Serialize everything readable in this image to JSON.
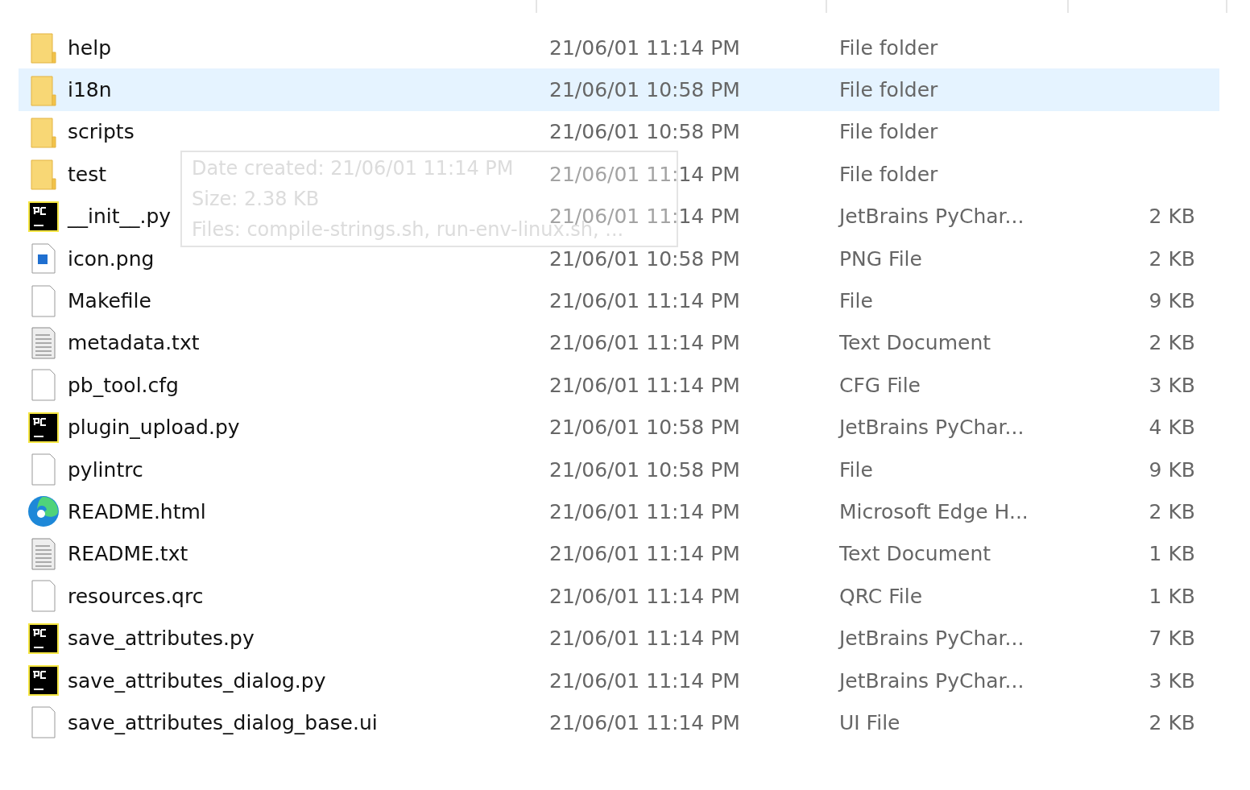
{
  "files": [
    {
      "name": "help",
      "kind": "folder",
      "date": "21/06/01 11:14 PM",
      "type": "File folder",
      "selected": false
    },
    {
      "name": "i18n",
      "kind": "folder",
      "date": "21/06/01 10:58 PM",
      "type": "File folder",
      "selected": true
    },
    {
      "name": "scripts",
      "kind": "folder",
      "date": "21/06/01 10:58 PM",
      "type": "File folder",
      "selected": false
    },
    {
      "name": "test",
      "kind": "folder",
      "date": "21/06/01 11:14 PM",
      "type": "File folder",
      "selected": false
    },
    {
      "name": "__init__.py",
      "kind": "pycharm",
      "date": "21/06/01 11:14 PM",
      "type": "JetBrains PyChar...",
      "size": "2 KB",
      "selected": false
    },
    {
      "name": "icon.png",
      "kind": "image",
      "date": "21/06/01 10:58 PM",
      "type": "PNG File",
      "size": "2 KB",
      "selected": false
    },
    {
      "name": "Makefile",
      "kind": "file",
      "date": "21/06/01 11:14 PM",
      "type": "File",
      "size": "9 KB",
      "selected": false
    },
    {
      "name": "metadata.txt",
      "kind": "text",
      "date": "21/06/01 11:14 PM",
      "type": "Text Document",
      "size": "2 KB",
      "selected": false
    },
    {
      "name": "pb_tool.cfg",
      "kind": "file",
      "date": "21/06/01 11:14 PM",
      "type": "CFG File",
      "size": "3 KB",
      "selected": false
    },
    {
      "name": "plugin_upload.py",
      "kind": "pycharm",
      "date": "21/06/01 10:58 PM",
      "type": "JetBrains PyChar...",
      "size": "4 KB",
      "selected": false
    },
    {
      "name": "pylintrc",
      "kind": "file",
      "date": "21/06/01 10:58 PM",
      "type": "File",
      "size": "9 KB",
      "selected": false
    },
    {
      "name": "README.html",
      "kind": "edge",
      "date": "21/06/01 11:14 PM",
      "type": "Microsoft Edge H...",
      "size": "2 KB",
      "selected": false
    },
    {
      "name": "README.txt",
      "kind": "text",
      "date": "21/06/01 11:14 PM",
      "type": "Text Document",
      "size": "1 KB",
      "selected": false
    },
    {
      "name": "resources.qrc",
      "kind": "file",
      "date": "21/06/01 11:14 PM",
      "type": "QRC File",
      "size": "1 KB",
      "selected": false
    },
    {
      "name": "save_attributes.py",
      "kind": "pycharm",
      "date": "21/06/01 11:14 PM",
      "type": "JetBrains PyChar...",
      "size": "7 KB",
      "selected": false
    },
    {
      "name": "save_attributes_dialog.py",
      "kind": "pycharm",
      "date": "21/06/01 11:14 PM",
      "type": "JetBrains PyChar...",
      "size": "3 KB",
      "selected": false
    },
    {
      "name": "save_attributes_dialog_base.ui",
      "kind": "file",
      "date": "21/06/01 11:14 PM",
      "type": "UI File",
      "size": "2 KB",
      "selected": false
    }
  ],
  "tooltip": {
    "lines": [
      "Date created: 21/06/01 11:14 PM",
      "Size: 2.38 KB",
      "Files: compile-strings.sh, run-env-linux.sh, ..."
    ]
  }
}
